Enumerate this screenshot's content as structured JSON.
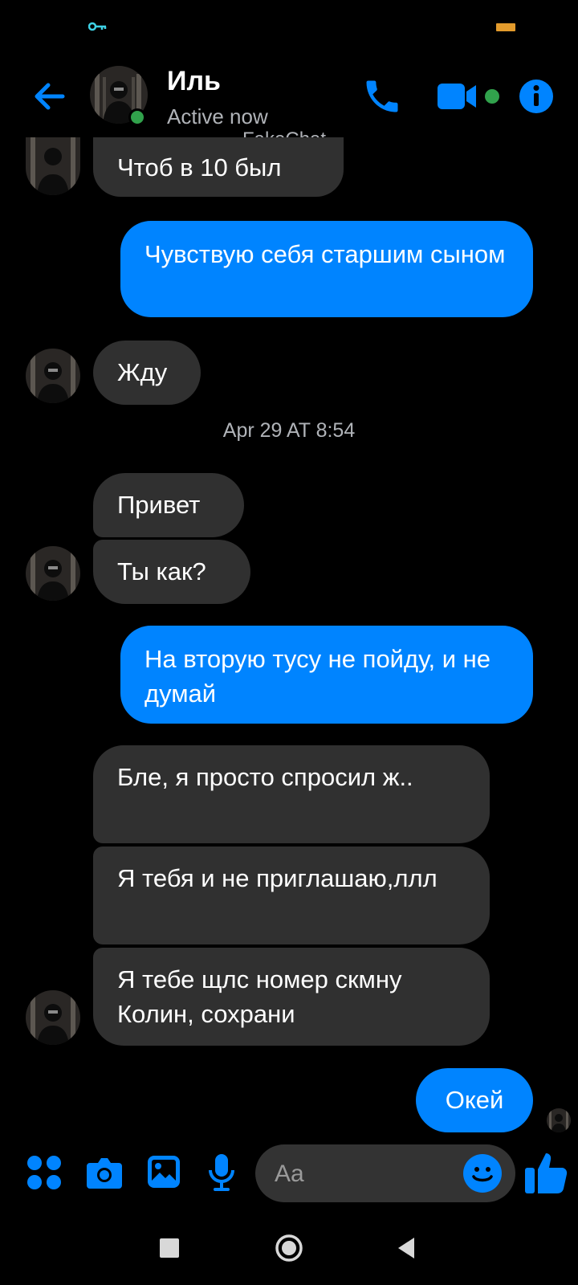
{
  "header": {
    "name": "Иль",
    "status": "Active now",
    "watermark": "FakeChat"
  },
  "timestamp": "Apr 29 AT 8:54",
  "messages": [
    {
      "dir": "in",
      "text": "Чтоб в 10 был"
    },
    {
      "dir": "out",
      "text": "Чувствую себя старшим сыном"
    },
    {
      "dir": "in",
      "text": "Жду"
    },
    {
      "dir": "in",
      "text": "Привет"
    },
    {
      "dir": "in",
      "text": "Ты как?"
    },
    {
      "dir": "out",
      "text": "На вторую тусу не пойду, и не думай"
    },
    {
      "dir": "in",
      "text": "Бле, я просто спросил ж.."
    },
    {
      "dir": "in",
      "text": "Я тебя и не приглашаю,ллл"
    },
    {
      "dir": "in",
      "text": "Я тебе щлс номер скмну Колин, сохрани"
    },
    {
      "dir": "out",
      "text": "Окей"
    }
  ],
  "composer": {
    "placeholder": "Aa"
  },
  "colors": {
    "accent": "#0084ff",
    "incoming_bubble": "#303030",
    "online": "#31a24c",
    "background": "#000000"
  },
  "icons": [
    "key-icon",
    "battery-icon",
    "back-arrow-icon",
    "phone-icon",
    "video-icon",
    "info-icon",
    "apps-icon",
    "camera-icon",
    "gallery-icon",
    "microphone-icon",
    "emoji-icon",
    "thumbs-up-icon"
  ]
}
